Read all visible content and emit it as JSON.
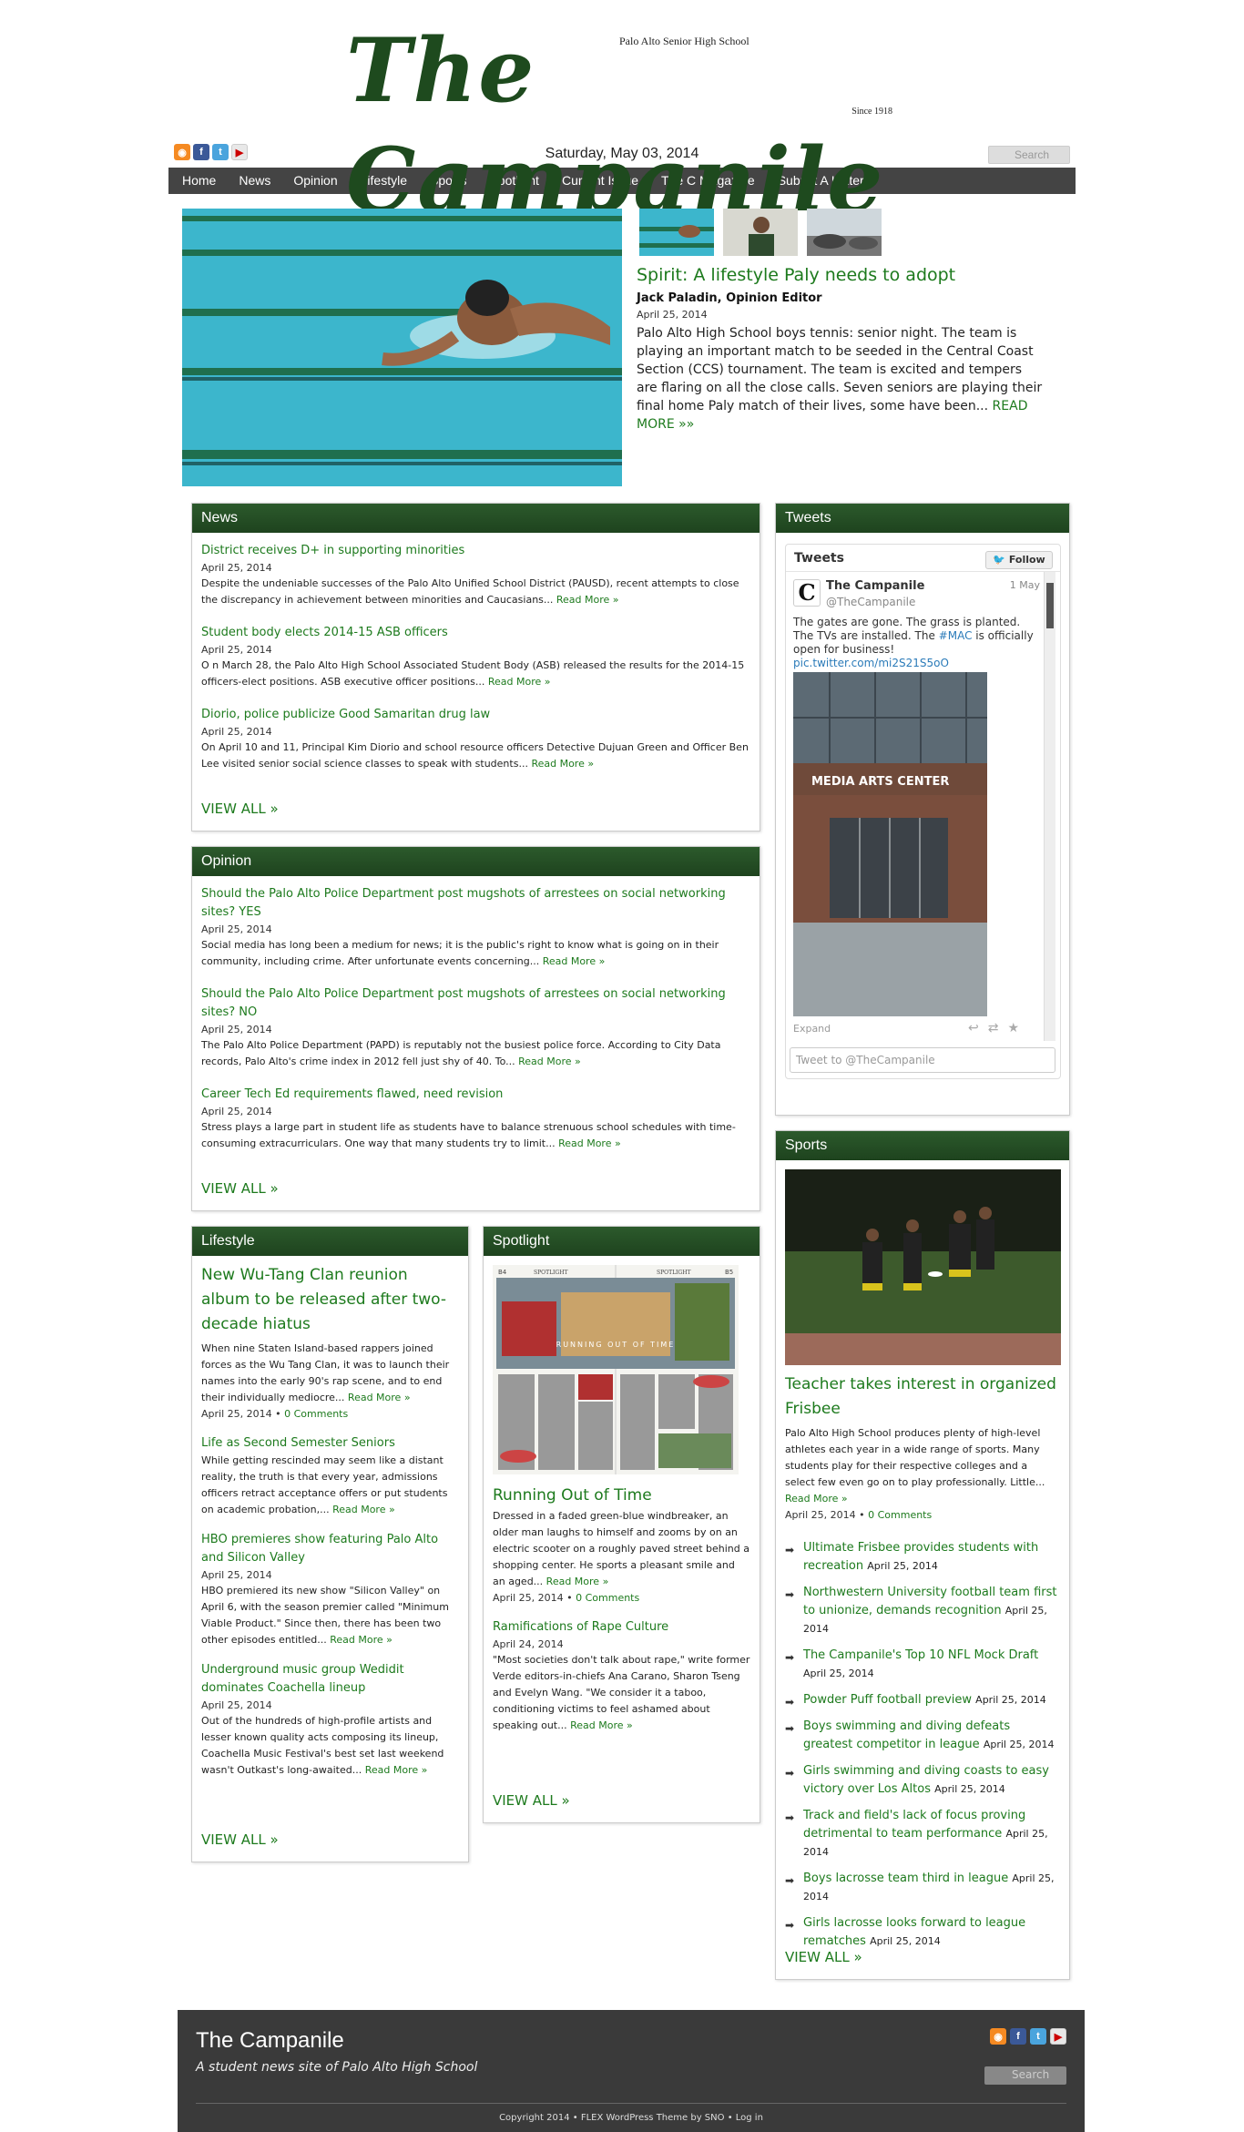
{
  "masthead": {
    "title": "The Campanile",
    "school": "Palo Alto Senior High School",
    "since": "Since 1918"
  },
  "topbar": {
    "date": "Saturday, May 03, 2014",
    "search_placeholder": "Search",
    "social_icons": [
      "rss-icon",
      "facebook-icon",
      "twitter-icon",
      "youtube-icon"
    ]
  },
  "nav": [
    "Home",
    "News",
    "Opinion",
    "Lifestyle",
    "Sports",
    "Spotlight",
    "Current Issue",
    "The C Magazine",
    "Submit A Letter"
  ],
  "featured": {
    "title": "Spirit: A lifestyle Paly needs to adopt",
    "author": "Jack Paladin, Opinion Editor",
    "date": "April 25, 2014",
    "body": "Palo Alto High School boys tennis: senior night. The team is playing an important match to be seeded in the Central Coast Section (CCS) tournament. The team is excited and tempers are flaring on all the close calls. Seven seniors are playing their final home Paly match of their lives, some have been...",
    "read_more": "READ MORE »»"
  },
  "news": {
    "heading": "News",
    "items": [
      {
        "title": "District receives D+ in supporting minorities",
        "date": "April 25, 2014",
        "excerpt": "Despite the undeniable successes of the Palo Alto Unified School District (PAUSD), recent attempts to close the discrepancy in achievement between minorities and Caucasians...",
        "more": "Read More »"
      },
      {
        "title": "Student body elects 2014-15 ASB officers",
        "date": "April 25, 2014",
        "excerpt": "O n March 28, the Palo Alto High School Associated Student Body (ASB) released the results for the 2014-15 officers-elect positions. ASB executive officer positions...",
        "more": "Read More »"
      },
      {
        "title": "Diorio, police publicize Good Samaritan drug law",
        "date": "April 25, 2014",
        "excerpt": "On April 10 and 11, Principal Kim Diorio and school resource officers Detective Dujuan Green and Officer Ben Lee visited senior social science classes to speak with students...",
        "more": "Read More »"
      }
    ],
    "view_all": "VIEW ALL »"
  },
  "opinion": {
    "heading": "Opinion",
    "items": [
      {
        "title": "Should the Palo Alto Police Department post mugshots of arrestees on social networking sites? YES",
        "date": "April 25, 2014",
        "excerpt": "Social media has long been a medium for news; it is the public's right to know what is going on in their community, including crime. After unfortunate events concerning...",
        "more": "Read More »"
      },
      {
        "title": "Should the Palo Alto Police Department post mugshots of arrestees on social networking sites? NO",
        "date": "April 25, 2014",
        "excerpt": "The Palo Alto Police Department (PAPD) is reputably not the busiest police force. According to City Data records, Palo Alto's crime index in 2012 fell just shy of 40. To...",
        "more": "Read More »"
      },
      {
        "title": "Career Tech Ed requirements flawed, need revision",
        "date": "April 25, 2014",
        "excerpt": "Stress plays a large part in student life as students have to balance strenuous school schedules with time-consuming extracurriculars. One way that many students try to limit...",
        "more": "Read More »"
      }
    ],
    "view_all": "VIEW ALL »"
  },
  "tweets": {
    "heading": "Tweets",
    "box_title": "Tweets",
    "follow": "Follow",
    "name": "The Campanile",
    "handle": "@TheCampanile",
    "time": "1 May",
    "avatar": "C",
    "text": "The gates are gone. The grass is planted. The TVs are installed. The",
    "hashtag": "#MAC",
    "text2": "is officially open for business!",
    "link": "pic.twitter.com/mi2S21S5oO",
    "photo_sign": "MEDIA ARTS CENTER",
    "expand": "Expand",
    "input_placeholder": "Tweet to @TheCampanile"
  },
  "lifestyle": {
    "heading": "Lifestyle",
    "lead": {
      "title": "New Wu-Tang Clan reunion album to be released after two-decade hiatus",
      "excerpt": "When nine Staten Island-based rappers joined forces as the Wu Tang Clan, it was to launch their names into the early 90's rap scene, and to end their individually mediocre...",
      "more": "Read More »",
      "date": "April 25, 2014",
      "comments": "0 Comments"
    },
    "items": [
      {
        "title": "Life as Second Semester Seniors",
        "excerpt": "While getting rescinded may seem like a distant reality, the truth is that every year, admissions officers retract acceptance offers or put students on academic probation,...",
        "more": "Read More »"
      },
      {
        "title": "HBO premieres show featuring Palo Alto and Silicon Valley",
        "date": "April 25, 2014",
        "excerpt": "HBO premiered its new show \"Silicon Valley\" on April 6, with the season premier called \"Minimum Viable Product.\" Since then, there has been two other episodes entitled...",
        "more": "Read More »"
      },
      {
        "title": "Underground music group Wedidit dominates Coachella lineup",
        "date": "April 25, 2014",
        "excerpt": "Out of the hundreds of high-profile artists and lesser known quality acts composing its lineup, Coachella Music Festival's best set last weekend wasn't Outkast's long-awaited...",
        "more": "Read More »"
      }
    ],
    "view_all": "VIEW ALL »"
  },
  "spotlight": {
    "heading": "Spotlight",
    "image_texts": {
      "page_left": "B4",
      "page_right": "B5",
      "section": "SPOTLIGHT",
      "headline": "RUNNING OUT OF TIME"
    },
    "lead": {
      "title": "Running Out of Time",
      "excerpt": "Dressed in a faded green-blue windbreaker, an older man laughs to himself and zooms by on an electric scooter on a roughly paved street behind a shopping center. He sports a pleasant smile and an aged...",
      "more": "Read More »",
      "date": "April 25, 2014",
      "comments": "0 Comments"
    },
    "items": [
      {
        "title": "Ramifications of Rape Culture",
        "date": "April 24, 2014",
        "excerpt": "\"Most societies don't talk about rape,\" write former Verde editors-in-chiefs Ana Carano, Sharon Tseng and Evelyn Wang. \"We consider it a taboo, conditioning victims to feel ashamed about speaking out...",
        "more": "Read More »"
      }
    ],
    "view_all": "VIEW ALL »"
  },
  "sports": {
    "heading": "Sports",
    "lead": {
      "title": "Teacher takes interest in organized Frisbee",
      "excerpt": "Palo Alto High School produces plenty of high-level athletes each year in a wide range of sports. Many students play for their respective colleges and a select few even go on to play professionally. Little...",
      "more": "Read More »",
      "date": "April 25, 2014",
      "comments": "0 Comments"
    },
    "list": [
      {
        "title": "Ultimate Frisbee provides students with recreation",
        "date": "April 25, 2014"
      },
      {
        "title": "Northwestern University football team first to unionize, demands recognition",
        "date": "April 25, 2014"
      },
      {
        "title": "The Campanile's Top 10 NFL Mock Draft",
        "date": "April 25, 2014"
      },
      {
        "title": "Powder Puff football preview",
        "date": "April 25, 2014"
      },
      {
        "title": "Boys swimming and diving defeats greatest competitor in league",
        "date": "April 25, 2014"
      },
      {
        "title": "Girls swimming and diving coasts to easy victory over Los Altos",
        "date": "April 25, 2014"
      },
      {
        "title": "Track and field's lack of focus proving detrimental to team performance",
        "date": "April 25, 2014"
      },
      {
        "title": "Boys lacrosse team third in league",
        "date": "April 25, 2014"
      },
      {
        "title": "Girls lacrosse looks forward to league rematches",
        "date": "April 25, 2014"
      }
    ],
    "view_all": "VIEW ALL »"
  },
  "footer": {
    "title": "The Campanile",
    "tagline": "A student news site of Palo Alto High School",
    "search_placeholder": "Search",
    "copyright": "Copyright 2014 • FLEX WordPress Theme by SNO • Log in"
  },
  "colors": {
    "accent": "#1d7a1d",
    "header_green": "#1e431e",
    "nav_bg": "#444444",
    "footer_bg": "#3a3a3a"
  }
}
